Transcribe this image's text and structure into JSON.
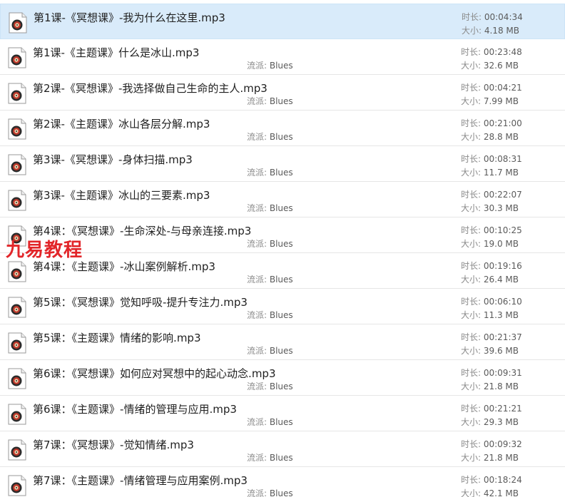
{
  "labels": {
    "duration": "时长: ",
    "size": "大小: ",
    "genre": "流派: "
  },
  "watermark": "九易教程",
  "files": [
    {
      "name": "第1课-《冥想课》-我为什么在这里.mp3",
      "duration": "00:04:34",
      "size": "4.18 MB",
      "genre": "",
      "selected": true
    },
    {
      "name": "第1课-《主题课》什么是冰山.mp3",
      "duration": "00:23:48",
      "size": "32.6 MB",
      "genre": "Blues",
      "selected": false
    },
    {
      "name": "第2课-《冥想课》-我选择做自己生命的主人.mp3",
      "duration": "00:04:21",
      "size": "7.99 MB",
      "genre": "Blues",
      "selected": false
    },
    {
      "name": "第2课-《主题课》冰山各层分解.mp3",
      "duration": "00:21:00",
      "size": "28.8 MB",
      "genre": "Blues",
      "selected": false
    },
    {
      "name": "第3课-《冥想课》-身体扫描.mp3",
      "duration": "00:08:31",
      "size": "11.7 MB",
      "genre": "Blues",
      "selected": false
    },
    {
      "name": "第3课-《主题课》冰山的三要素.mp3",
      "duration": "00:22:07",
      "size": "30.3 MB",
      "genre": "Blues",
      "selected": false
    },
    {
      "name": "第4课：《冥想课》-生命深处-与母亲连接.mp3",
      "duration": "00:10:25",
      "size": "19.0 MB",
      "genre": "Blues",
      "selected": false
    },
    {
      "name": "第4课：《主题课》-冰山案例解析.mp3",
      "duration": "00:19:16",
      "size": "26.4 MB",
      "genre": "Blues",
      "selected": false
    },
    {
      "name": "第5课：《冥想课》觉知呼吸-提升专注力.mp3",
      "duration": "00:06:10",
      "size": "11.3 MB",
      "genre": "Blues",
      "selected": false
    },
    {
      "name": "第5课：《主题课》情绪的影响.mp3",
      "duration": "00:21:37",
      "size": "39.6 MB",
      "genre": "Blues",
      "selected": false
    },
    {
      "name": "第6课：《冥想课》如何应对冥想中的起心动念.mp3",
      "duration": "00:09:31",
      "size": "21.8 MB",
      "genre": "Blues",
      "selected": false
    },
    {
      "name": "第6课：《主题课》-情绪的管理与应用.mp3",
      "duration": "00:21:21",
      "size": "29.3 MB",
      "genre": "Blues",
      "selected": false
    },
    {
      "name": "第7课：《冥想课》-觉知情绪.mp3",
      "duration": "00:09:32",
      "size": "21.8 MB",
      "genre": "Blues",
      "selected": false
    },
    {
      "name": "第7课：《主题课》-情绪管理与应用案例.mp3",
      "duration": "00:18:24",
      "size": "42.1 MB",
      "genre": "Blues",
      "selected": false
    }
  ]
}
